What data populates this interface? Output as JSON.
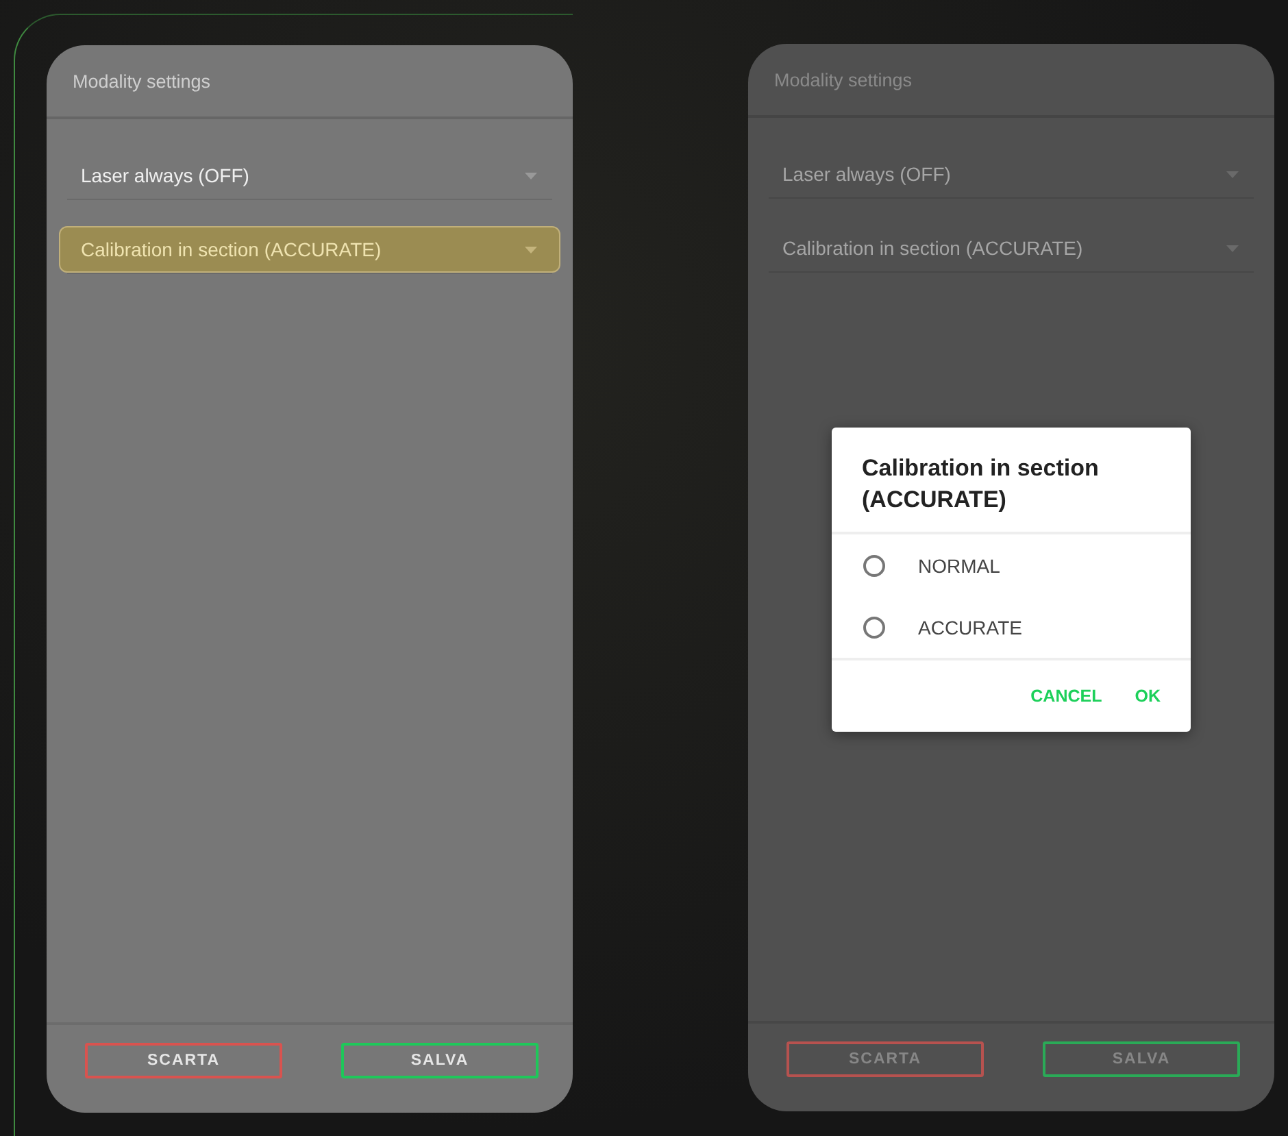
{
  "screens": [
    {
      "title": "Modality settings",
      "dimmed": false,
      "settings": [
        {
          "label": "Laser always (OFF)",
          "selected": false
        },
        {
          "label": "Calibration in section (ACCURATE)",
          "selected": true
        }
      ],
      "buttons": [
        {
          "label": "SCARTA",
          "kind": "discard"
        },
        {
          "label": "SALVA",
          "kind": "save"
        }
      ]
    },
    {
      "title": "Modality settings",
      "dimmed": true,
      "settings": [
        {
          "label": "Laser always (OFF)",
          "selected": false
        },
        {
          "label": "Calibration in section (ACCURATE)",
          "selected": false
        }
      ],
      "buttons": [
        {
          "label": "SCARTA",
          "kind": "discard"
        },
        {
          "label": "SALVA",
          "kind": "save"
        }
      ],
      "dialog": {
        "title": "Calibration in section (ACCURATE)",
        "options": [
          {
            "label": "NORMAL",
            "selected": false
          },
          {
            "label": "ACCURATE",
            "selected": false
          }
        ],
        "actions": [
          "CANCEL",
          "OK"
        ]
      }
    }
  ]
}
